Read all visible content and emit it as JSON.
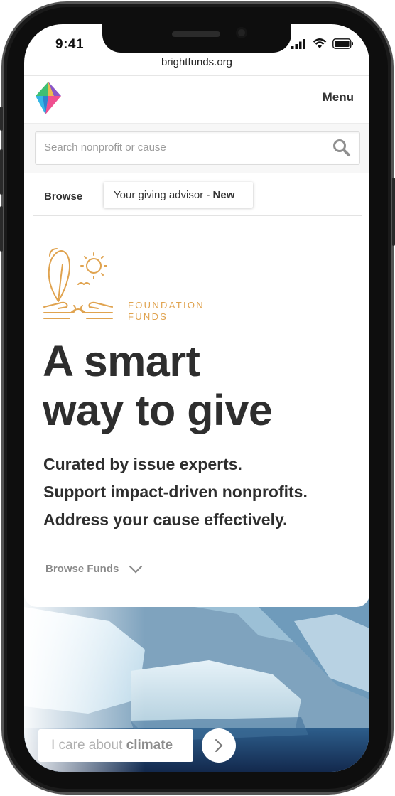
{
  "status_bar": {
    "time": "9:41"
  },
  "browser": {
    "url": "brightfunds.org"
  },
  "header": {
    "menu_label": "Menu"
  },
  "search": {
    "placeholder": "Search nonprofit or cause"
  },
  "tabs": {
    "browse_label": "Browse",
    "advisor_label": "Your giving advisor - ",
    "advisor_badge": "New"
  },
  "hero": {
    "eyebrow_line1": "FOUNDATION",
    "eyebrow_line2": "FUNDS",
    "headline_line1": "A smart",
    "headline_line2": "way to give",
    "taglines": [
      "Curated by issue experts.",
      "Support impact-driven nonprofits.",
      "Address your cause effectively."
    ],
    "browse_funds_label": "Browse Funds"
  },
  "cause": {
    "prefix": "I care about ",
    "topic": "climate"
  },
  "colors": {
    "accent_gold": "#e0a34f",
    "text_dark": "#2e2e2e",
    "muted": "#8a8a8a"
  }
}
